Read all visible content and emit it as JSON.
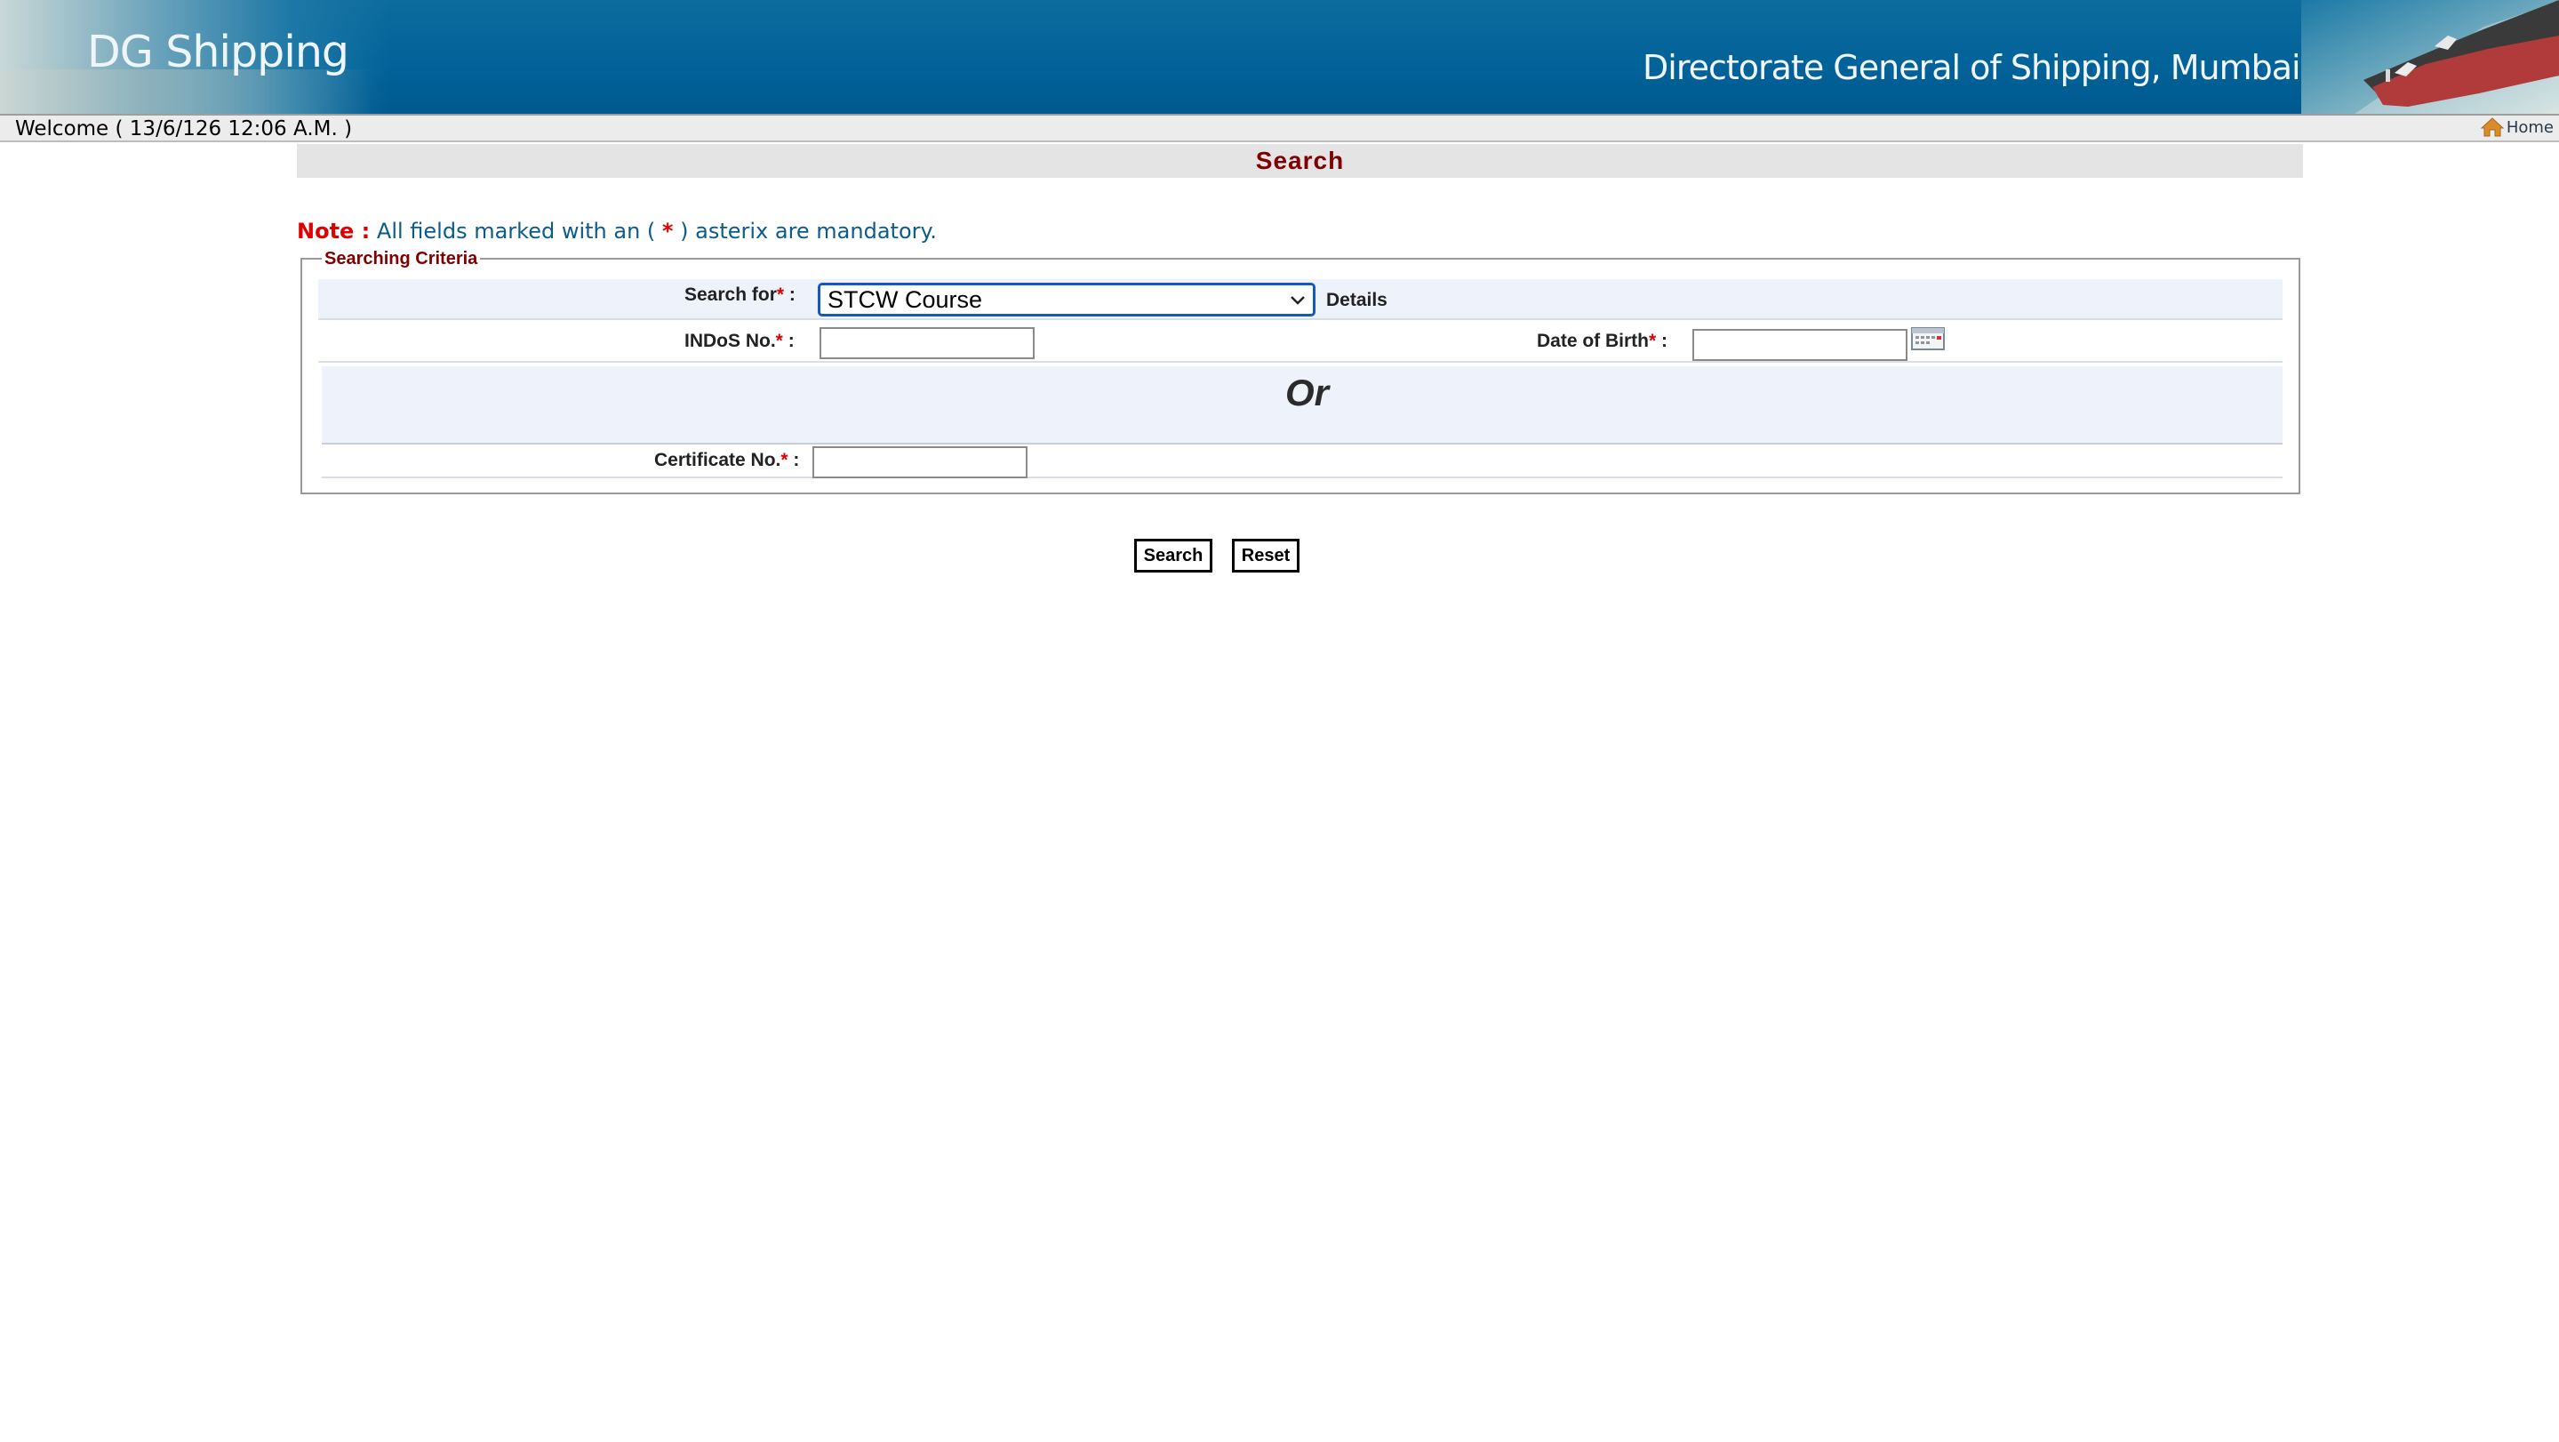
{
  "header": {
    "brand": "DG Shipping",
    "organization": "Directorate General of Shipping, Mumbai"
  },
  "welcome": {
    "text": "Welcome ( 13/6/126 12:06 A.M. )",
    "home_label": "Home"
  },
  "page": {
    "title": "Search"
  },
  "note": {
    "label": "Note :",
    "text_before": " All fields marked with an ( ",
    "star": "*",
    "text_after": " ) asterix are mandatory."
  },
  "criteria": {
    "legend": "Searching Criteria",
    "search_for": {
      "label": "Search for",
      "required_mark": "*",
      "suffix": " :",
      "selected": "STCW Course",
      "details_label": "Details"
    },
    "indos": {
      "label": "INDoS No.",
      "required_mark": "*",
      "suffix": " :",
      "value": ""
    },
    "dob": {
      "label": "Date of Birth",
      "required_mark": "*",
      "suffix": " :",
      "value": ""
    },
    "or_label": "Or",
    "certificate": {
      "label": "Certificate No.",
      "required_mark": "*",
      "suffix": " :",
      "value": ""
    }
  },
  "buttons": {
    "search": "Search",
    "reset": "Reset"
  },
  "colors": {
    "banner_blue": "#02639a",
    "title_maroon": "#7f0000",
    "required_red": "#e00000",
    "note_blue": "#0b5c8a",
    "row_tint": "#eef2fb",
    "select_border": "#1558c0"
  },
  "icons": [
    "ship-image",
    "home-icon",
    "chevron-down-icon",
    "calendar-icon"
  ]
}
